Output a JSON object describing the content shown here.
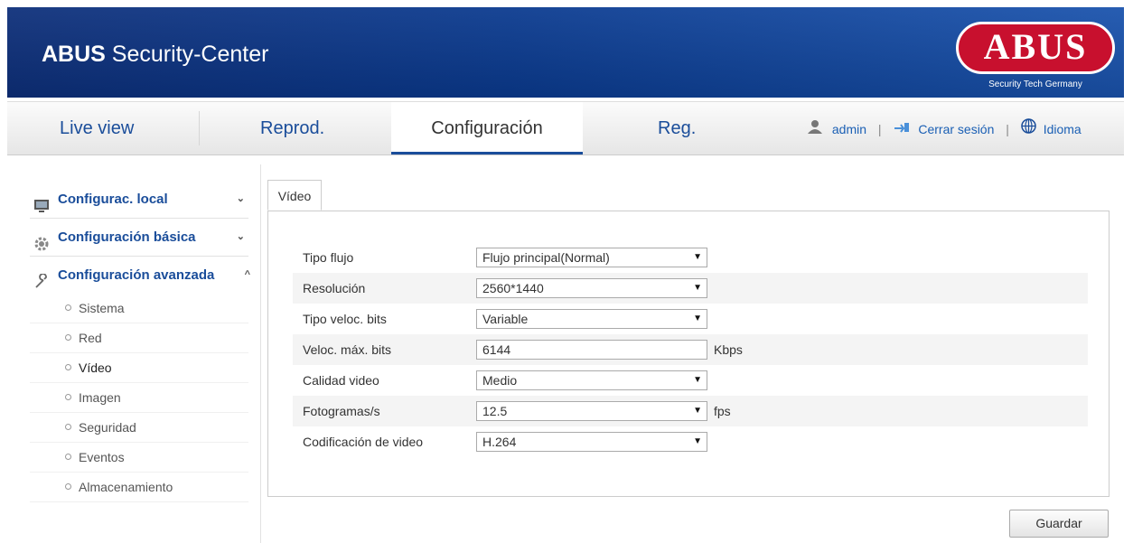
{
  "header": {
    "title_bold": "ABUS",
    "title_rest": " Security-Center",
    "logo_text": "ABUS",
    "logo_tagline": "Security Tech Germany"
  },
  "nav": {
    "tabs": [
      {
        "label": "Live view"
      },
      {
        "label": "Reprod."
      },
      {
        "label": "Configuración",
        "active": true
      },
      {
        "label": "Reg."
      }
    ],
    "user": "admin",
    "logout": "Cerrar sesión",
    "language": "Idioma"
  },
  "sidebar": {
    "groups": [
      {
        "label": "Configurac. local",
        "icon": "computer-icon",
        "chevron": "⌄"
      },
      {
        "label": "Configuración básica",
        "icon": "gear-icon",
        "chevron": "⌄"
      },
      {
        "label": "Configuración avanzada",
        "icon": "wrench-icon",
        "chevron": "^"
      }
    ],
    "items": [
      {
        "label": "Sistema"
      },
      {
        "label": "Red"
      },
      {
        "label": "Vídeo",
        "active": true
      },
      {
        "label": "Imagen"
      },
      {
        "label": "Seguridad"
      },
      {
        "label": "Eventos"
      },
      {
        "label": "Almacenamiento"
      }
    ]
  },
  "content": {
    "tab_label": "Vídeo",
    "fields": [
      {
        "label": "Tipo flujo",
        "value": "Flujo principal(Normal)",
        "type": "select"
      },
      {
        "label": "Resolución",
        "value": "2560*1440",
        "type": "select"
      },
      {
        "label": "Tipo veloc. bits",
        "value": "Variable",
        "type": "select"
      },
      {
        "label": "Veloc. máx. bits",
        "value": "6144",
        "type": "input",
        "unit": "Kbps"
      },
      {
        "label": "Calidad video",
        "value": "Medio",
        "type": "select"
      },
      {
        "label": "Fotogramas/s",
        "value": "12.5",
        "type": "select",
        "unit": "fps"
      },
      {
        "label": "Codificación de video",
        "value": "H.264",
        "type": "select"
      }
    ],
    "save_label": "Guardar"
  },
  "colors": {
    "banner": "#0d2f7a",
    "link": "#1a4d9a",
    "logo_red": "#c8102e"
  }
}
